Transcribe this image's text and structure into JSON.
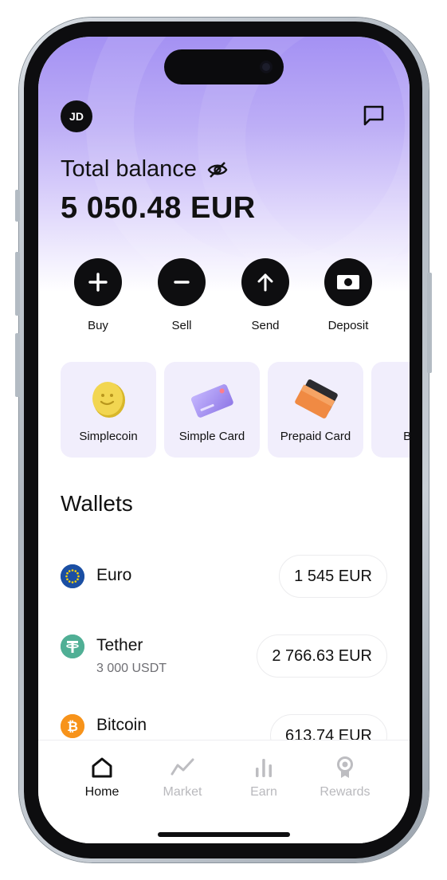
{
  "header": {
    "avatar_initials": "JD",
    "chat_icon": "chat-bubble-icon"
  },
  "balance": {
    "label": "Total balance",
    "amount": "5 050.48 EUR",
    "visibility_icon": "eye-off-icon"
  },
  "actions": [
    {
      "label": "Buy",
      "icon": "plus-icon"
    },
    {
      "label": "Sell",
      "icon": "minus-icon"
    },
    {
      "label": "Send",
      "icon": "arrow-up-icon"
    },
    {
      "label": "Deposit",
      "icon": "cash-icon"
    }
  ],
  "cards": [
    {
      "label": "Simplecoin",
      "icon": "coin-icon"
    },
    {
      "label": "Simple Card",
      "icon": "credit-card-icon"
    },
    {
      "label": "Prepaid Card",
      "icon": "prepaid-card-icon"
    },
    {
      "label": "Buy",
      "icon": "coin-icon"
    }
  ],
  "wallets": {
    "title": "Wallets",
    "items": [
      {
        "name": "Euro",
        "subtitle": "",
        "amount": "1 545 EUR",
        "icon": "euro-flag-icon",
        "color": "#1b4fa3"
      },
      {
        "name": "Tether",
        "subtitle": "3 000 USDT",
        "amount": "2 766.63 EUR",
        "icon": "tether-icon",
        "color": "#50af95"
      },
      {
        "name": "Bitcoin",
        "subtitle": "",
        "amount": "613.74 EUR",
        "icon": "bitcoin-icon",
        "color": "#f7931a"
      }
    ]
  },
  "tabbar": [
    {
      "label": "Home",
      "icon": "home-icon",
      "active": true
    },
    {
      "label": "Market",
      "icon": "chart-line-icon",
      "active": false
    },
    {
      "label": "Earn",
      "icon": "bar-chart-icon",
      "active": false
    },
    {
      "label": "Rewards",
      "icon": "award-icon",
      "active": false
    }
  ],
  "colors": {
    "accent": "#a491f3",
    "card_bg": "#f1eefc",
    "text": "#111111",
    "muted": "#b9b9bd"
  }
}
